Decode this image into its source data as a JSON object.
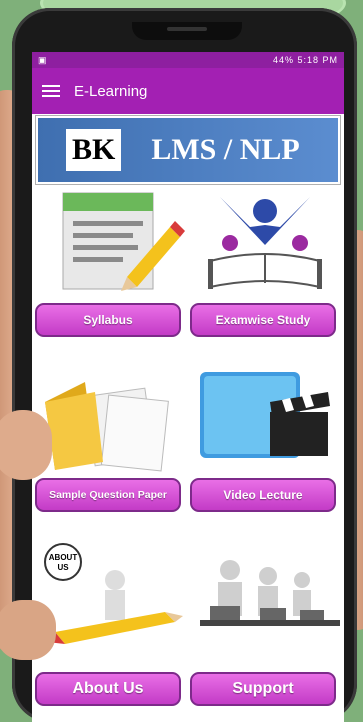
{
  "status_bar": {
    "left_icon": "image-icon",
    "right": "44% 5:18 PM"
  },
  "app_bar": {
    "title": "E-Learning"
  },
  "banner": {
    "prefix": "BK",
    "title": "LMS / NLP"
  },
  "tiles": [
    {
      "label": "Syllabus",
      "icon": "document-pencil-icon"
    },
    {
      "label": "Examwise Study",
      "icon": "reading-person-icon"
    },
    {
      "label": "Sample Question Paper",
      "icon": "folder-icon"
    },
    {
      "label": "Video Lecture",
      "icon": "video-clapper-icon"
    },
    {
      "label": "About Us",
      "icon": "about-us-sign-icon",
      "sign_text": "ABOUT US"
    },
    {
      "label": "Support",
      "icon": "headset-support-icon"
    }
  ],
  "colors": {
    "app_bar": "#a320b3",
    "status_bar": "#8e1fa0",
    "button": "#d44fd4",
    "banner": "#4a7cc0"
  }
}
